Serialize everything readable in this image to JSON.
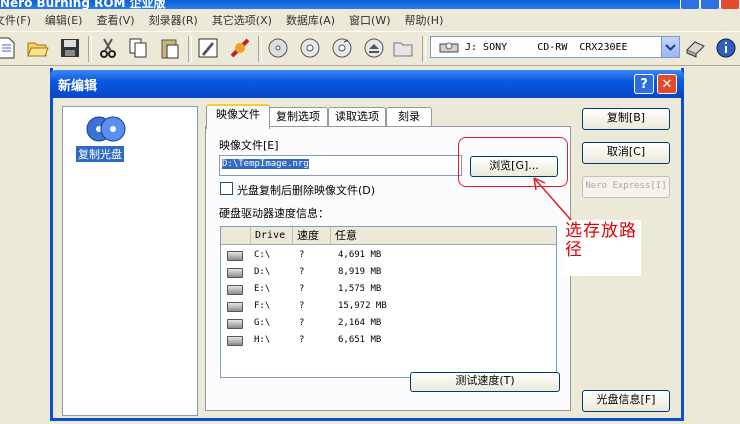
{
  "app": {
    "title": "Nero Burning ROM 企业版"
  },
  "menubar": {
    "items": [
      "文件(F)",
      "编辑(E)",
      "查看(V)",
      "刻录器(R)",
      "其它选项(X)",
      "数据库(A)",
      "窗口(W)",
      "帮助(H)"
    ]
  },
  "toolbar": {
    "icons": [
      "new-icon",
      "open-folder-icon",
      "save-icon",
      "cut-icon",
      "copy-icon",
      "paste-icon",
      "edit-icon",
      "burn-icon",
      "disc-info-icon",
      "disc-icon",
      "copy-disc-icon",
      "eject-icon",
      "folder-icon",
      "drive-icon",
      "erase-icon",
      "properties-icon"
    ],
    "drive_select": "J: SONY     CD-RW  CRX230EE"
  },
  "dialog": {
    "title": "新编辑",
    "help_label": "?",
    "close_label": "✕",
    "left_pane": {
      "item_label": "复制光盘"
    },
    "tabs": [
      "映像文件",
      "复制选项",
      "读取选项",
      "刻录"
    ],
    "image_file_label": "映像文件[E]",
    "image_path_value": "D:\\TempImage.nrg",
    "browse_label": "浏览[G]...",
    "delete_after_copy_label": "光盘复制后删除映像文件(D)",
    "speed_info_label": "硬盘驱动器速度信息：",
    "table": {
      "columns": [
        "Drive",
        "速度",
        "任意"
      ],
      "rows": [
        {
          "drive": "C:\\",
          "speed": "?",
          "free": "4,691 MB"
        },
        {
          "drive": "D:\\",
          "speed": "?",
          "free": "8,919 MB"
        },
        {
          "drive": "E:\\",
          "speed": "?",
          "free": "1,575 MB"
        },
        {
          "drive": "F:\\",
          "speed": "?",
          "free": "15,972 MB"
        },
        {
          "drive": "G:\\",
          "speed": "?",
          "free": "2,164 MB"
        },
        {
          "drive": "H:\\",
          "speed": "?",
          "free": "6,651 MB"
        }
      ]
    },
    "test_speed_label": "测试速度(T)",
    "buttons": {
      "copy": "复制[B]",
      "cancel": "取消[C]",
      "nero_express": "Nero Express[I]",
      "disc_info": "光盘信息[F]"
    }
  },
  "annotation": {
    "text": "选存放路径"
  },
  "colors": {
    "accent": "#0a58e0",
    "annotation": "#e00000",
    "selection": "#316ac5"
  }
}
